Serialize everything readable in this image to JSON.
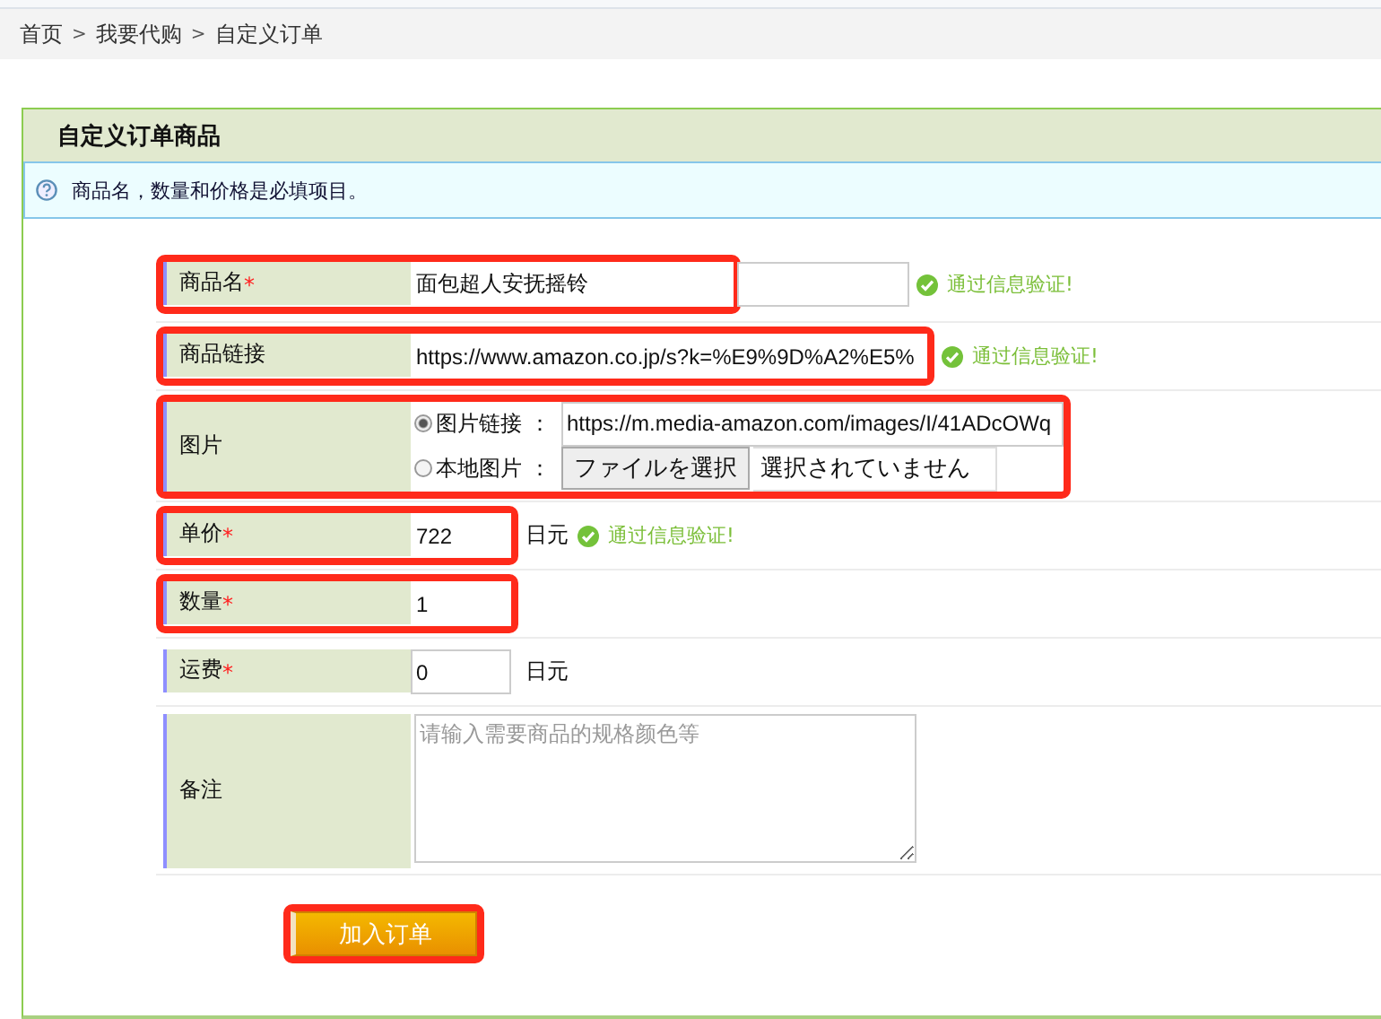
{
  "breadcrumb": [
    "首页",
    "我要代购",
    "自定义订单"
  ],
  "breadcrumb_separator": ">",
  "panel": {
    "title": "自定义订单商品",
    "info": "商品名，数量和价格是必填项目。"
  },
  "rows": [
    {
      "kind": "long-text",
      "label": "商品名",
      "required_mark": "*",
      "highlighted": true,
      "value": "面包超人安抚摇铃",
      "validation": "通过信息验证!"
    },
    {
      "kind": "long-text",
      "label": "商品链接",
      "highlighted": true,
      "value": "https://www.amazon.co.jp/s?k=%E9%9D%A2%E5%",
      "validation": "通过信息验证!"
    },
    {
      "kind": "image",
      "label": "图片",
      "highlighted": true,
      "options": [
        {
          "label": "图片链接 ：",
          "selected": true,
          "value": "https://m.media-amazon.com/images/I/41ADcOWq"
        },
        {
          "label": "本地图片 ：",
          "selected": false,
          "button": "ファイルを選択",
          "status": "選択されていません"
        }
      ]
    },
    {
      "kind": "number",
      "label": "单价",
      "required_mark": "*",
      "highlighted": true,
      "value": "722",
      "suffix": "日元",
      "validation": "通过信息验证!"
    },
    {
      "kind": "number",
      "label": "数量",
      "required_mark": "*",
      "highlighted": true,
      "value": "1"
    },
    {
      "kind": "number",
      "label": "运费",
      "required_mark": "*",
      "highlighted": false,
      "value": "0",
      "suffix": "日元"
    },
    {
      "kind": "textarea",
      "label": "备注",
      "highlighted": false,
      "placeholder": "请输入需要商品的规格颜色等"
    }
  ],
  "submit": {
    "label": "加入订单",
    "highlighted": true
  }
}
